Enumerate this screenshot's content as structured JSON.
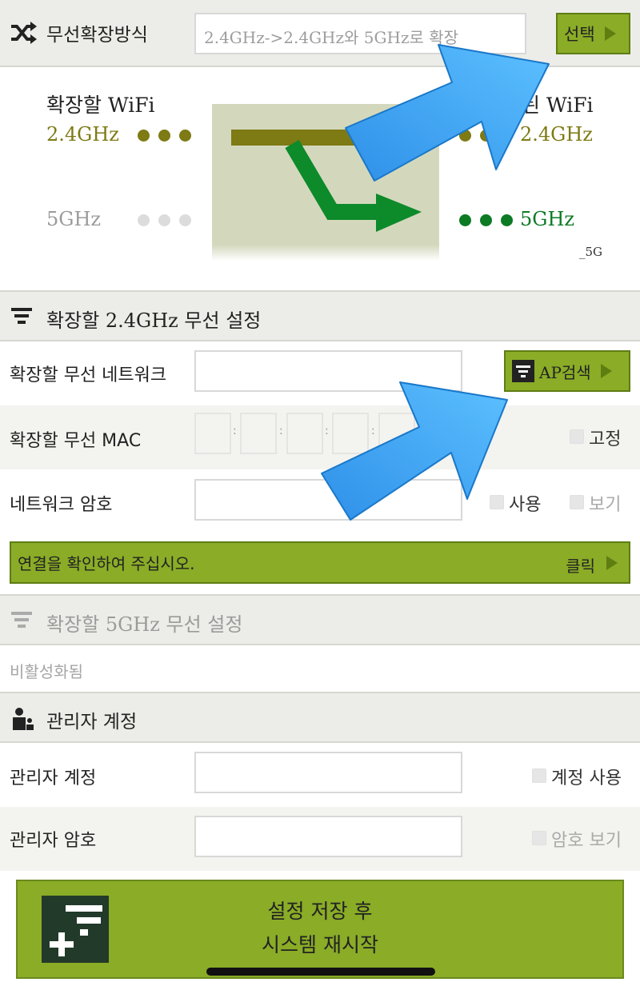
{
  "mode_section": {
    "title": "무선확장방식",
    "value": "2.4GHz->2.4GHz와 5GHz로 확장",
    "select_label": "선택"
  },
  "diagram": {
    "left_title": "확장할 WiFi",
    "right_title": "된 WiFi",
    "band_24": "2.4GHz",
    "band_5": "5GHz",
    "suffix_5g": "_5G",
    "colors": {
      "olive": "#7e7a14",
      "green": "#0d7a24",
      "gray": "#d8d8d8",
      "panel": "#d3d8bd"
    }
  },
  "section_24": {
    "title": "확장할 2.4GHz 무선 설정",
    "network_label": "확장할 무선 네트워크",
    "ap_search_label": "AP검색",
    "mac_label": "확장할 무선 MAC",
    "mac_separator": ":",
    "fixed_label": "고정",
    "password_label": "네트워크 암호",
    "use_label": "사용",
    "show_label": "보기",
    "confirm_text": "연결을 확인하여 주십시오.",
    "click_label": "클릭"
  },
  "section_5": {
    "title": "확장할 5GHz 무선 설정",
    "status": "비활성화됨"
  },
  "admin_section": {
    "title": "관리자 계정",
    "account_label": "관리자 계정",
    "use_account_label": "계정 사용",
    "password_label": "관리자 암호",
    "show_password_label": "암호 보기"
  },
  "save_button": {
    "line1": "설정 저장 후",
    "line2": "시스템 재시작"
  },
  "colors": {
    "accent": "#8aac27",
    "arrow_blue": "#3aa3f2"
  }
}
